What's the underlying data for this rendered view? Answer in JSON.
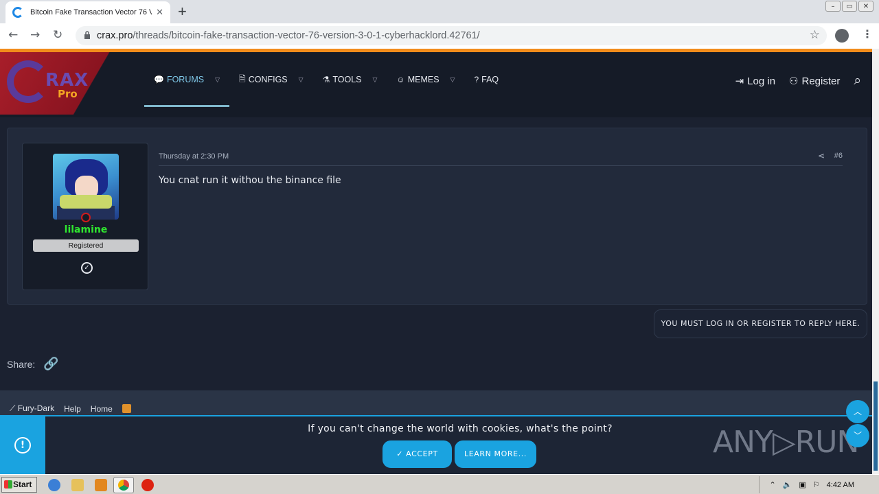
{
  "browser": {
    "tab_title": "Bitcoin Fake Transaction Vector 76 V",
    "tab_close": "✕",
    "new_tab": "+",
    "url_domain": "crax.pro",
    "url_path": "/threads/bitcoin-fake-transaction-vector-76-version-3-0-1-cyberhacklord.42761/",
    "back": "←",
    "forward": "→",
    "reload": "↻",
    "star": "☆",
    "menu": "⋮",
    "win_min": "–",
    "win_max": "▭",
    "win_close": "✕"
  },
  "site": {
    "logo_text": "RAX",
    "logo_sub": "Pro",
    "nav": [
      {
        "label": "FORUMS",
        "icon": "💬"
      },
      {
        "label": "CONFIGS",
        "icon": "🗎"
      },
      {
        "label": "TOOLS",
        "icon": "⚗"
      },
      {
        "label": "MEMES",
        "icon": "☺"
      },
      {
        "label": "FAQ",
        "icon": "?"
      }
    ],
    "caret": "▽",
    "login": "Log in",
    "register": "Register",
    "login_icon": "⇥",
    "register_icon": "⚇",
    "search_icon": "⌕"
  },
  "post": {
    "username": "lilamine",
    "user_title": "Registered",
    "date": "Thursday at 2:30 PM",
    "number": "#6",
    "share_icon": "⋖",
    "body": "You cnat run it withou the binance file",
    "check": "✓"
  },
  "reply_notice": "YOU MUST LOG IN OR REGISTER TO REPLY HERE.",
  "share": {
    "label": "Share:",
    "icon": "🔗"
  },
  "footer": {
    "style": "Fury-Dark",
    "style_icon": "⟋",
    "links": [
      "Help",
      "Home"
    ]
  },
  "cookie": {
    "message": "If you can't change the world with cookies, what's the point?",
    "accept": "ACCEPT",
    "accept_icon": "✓",
    "learn_more": "LEARN MORE...",
    "info_icon": "!"
  },
  "watermark": "ANY▷RUN",
  "scroll": {
    "up": "︿",
    "down": "﹀"
  },
  "taskbar": {
    "start": "Start",
    "clock": "4:42 AM"
  },
  "colors": {
    "accent": "#1aa3e0",
    "username": "#2fe52f",
    "orange": "#f28c1b"
  }
}
